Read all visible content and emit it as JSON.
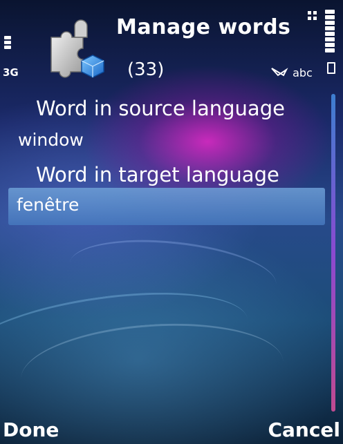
{
  "header": {
    "title": "Manage words",
    "count": "(33)",
    "network": "3G",
    "input_mode": "abc",
    "app_icon": "puzzle-piece-icon"
  },
  "form": {
    "source_label": "Word in source language",
    "source_value": "window",
    "target_label": "Word in target language",
    "target_value": "fenêtre"
  },
  "softkeys": {
    "left": "Done",
    "right": "Cancel"
  },
  "colors": {
    "selection": "#6ea0d7",
    "text": "#ffffff"
  }
}
